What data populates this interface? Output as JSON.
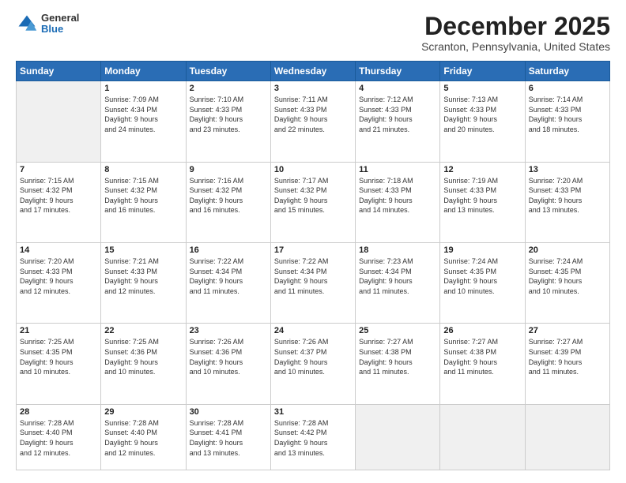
{
  "logo": {
    "general": "General",
    "blue": "Blue"
  },
  "title": "December 2025",
  "location": "Scranton, Pennsylvania, United States",
  "days_of_week": [
    "Sunday",
    "Monday",
    "Tuesday",
    "Wednesday",
    "Thursday",
    "Friday",
    "Saturday"
  ],
  "weeks": [
    [
      {
        "num": "",
        "info": ""
      },
      {
        "num": "1",
        "info": "Sunrise: 7:09 AM\nSunset: 4:34 PM\nDaylight: 9 hours\nand 24 minutes."
      },
      {
        "num": "2",
        "info": "Sunrise: 7:10 AM\nSunset: 4:33 PM\nDaylight: 9 hours\nand 23 minutes."
      },
      {
        "num": "3",
        "info": "Sunrise: 7:11 AM\nSunset: 4:33 PM\nDaylight: 9 hours\nand 22 minutes."
      },
      {
        "num": "4",
        "info": "Sunrise: 7:12 AM\nSunset: 4:33 PM\nDaylight: 9 hours\nand 21 minutes."
      },
      {
        "num": "5",
        "info": "Sunrise: 7:13 AM\nSunset: 4:33 PM\nDaylight: 9 hours\nand 20 minutes."
      },
      {
        "num": "6",
        "info": "Sunrise: 7:14 AM\nSunset: 4:33 PM\nDaylight: 9 hours\nand 18 minutes."
      }
    ],
    [
      {
        "num": "7",
        "info": "Sunrise: 7:15 AM\nSunset: 4:32 PM\nDaylight: 9 hours\nand 17 minutes."
      },
      {
        "num": "8",
        "info": "Sunrise: 7:15 AM\nSunset: 4:32 PM\nDaylight: 9 hours\nand 16 minutes."
      },
      {
        "num": "9",
        "info": "Sunrise: 7:16 AM\nSunset: 4:32 PM\nDaylight: 9 hours\nand 16 minutes."
      },
      {
        "num": "10",
        "info": "Sunrise: 7:17 AM\nSunset: 4:32 PM\nDaylight: 9 hours\nand 15 minutes."
      },
      {
        "num": "11",
        "info": "Sunrise: 7:18 AM\nSunset: 4:33 PM\nDaylight: 9 hours\nand 14 minutes."
      },
      {
        "num": "12",
        "info": "Sunrise: 7:19 AM\nSunset: 4:33 PM\nDaylight: 9 hours\nand 13 minutes."
      },
      {
        "num": "13",
        "info": "Sunrise: 7:20 AM\nSunset: 4:33 PM\nDaylight: 9 hours\nand 13 minutes."
      }
    ],
    [
      {
        "num": "14",
        "info": "Sunrise: 7:20 AM\nSunset: 4:33 PM\nDaylight: 9 hours\nand 12 minutes."
      },
      {
        "num": "15",
        "info": "Sunrise: 7:21 AM\nSunset: 4:33 PM\nDaylight: 9 hours\nand 12 minutes."
      },
      {
        "num": "16",
        "info": "Sunrise: 7:22 AM\nSunset: 4:34 PM\nDaylight: 9 hours\nand 11 minutes."
      },
      {
        "num": "17",
        "info": "Sunrise: 7:22 AM\nSunset: 4:34 PM\nDaylight: 9 hours\nand 11 minutes."
      },
      {
        "num": "18",
        "info": "Sunrise: 7:23 AM\nSunset: 4:34 PM\nDaylight: 9 hours\nand 11 minutes."
      },
      {
        "num": "19",
        "info": "Sunrise: 7:24 AM\nSunset: 4:35 PM\nDaylight: 9 hours\nand 10 minutes."
      },
      {
        "num": "20",
        "info": "Sunrise: 7:24 AM\nSunset: 4:35 PM\nDaylight: 9 hours\nand 10 minutes."
      }
    ],
    [
      {
        "num": "21",
        "info": "Sunrise: 7:25 AM\nSunset: 4:35 PM\nDaylight: 9 hours\nand 10 minutes."
      },
      {
        "num": "22",
        "info": "Sunrise: 7:25 AM\nSunset: 4:36 PM\nDaylight: 9 hours\nand 10 minutes."
      },
      {
        "num": "23",
        "info": "Sunrise: 7:26 AM\nSunset: 4:36 PM\nDaylight: 9 hours\nand 10 minutes."
      },
      {
        "num": "24",
        "info": "Sunrise: 7:26 AM\nSunset: 4:37 PM\nDaylight: 9 hours\nand 10 minutes."
      },
      {
        "num": "25",
        "info": "Sunrise: 7:27 AM\nSunset: 4:38 PM\nDaylight: 9 hours\nand 11 minutes."
      },
      {
        "num": "26",
        "info": "Sunrise: 7:27 AM\nSunset: 4:38 PM\nDaylight: 9 hours\nand 11 minutes."
      },
      {
        "num": "27",
        "info": "Sunrise: 7:27 AM\nSunset: 4:39 PM\nDaylight: 9 hours\nand 11 minutes."
      }
    ],
    [
      {
        "num": "28",
        "info": "Sunrise: 7:28 AM\nSunset: 4:40 PM\nDaylight: 9 hours\nand 12 minutes."
      },
      {
        "num": "29",
        "info": "Sunrise: 7:28 AM\nSunset: 4:40 PM\nDaylight: 9 hours\nand 12 minutes."
      },
      {
        "num": "30",
        "info": "Sunrise: 7:28 AM\nSunset: 4:41 PM\nDaylight: 9 hours\nand 13 minutes."
      },
      {
        "num": "31",
        "info": "Sunrise: 7:28 AM\nSunset: 4:42 PM\nDaylight: 9 hours\nand 13 minutes."
      },
      {
        "num": "",
        "info": ""
      },
      {
        "num": "",
        "info": ""
      },
      {
        "num": "",
        "info": ""
      }
    ]
  ]
}
